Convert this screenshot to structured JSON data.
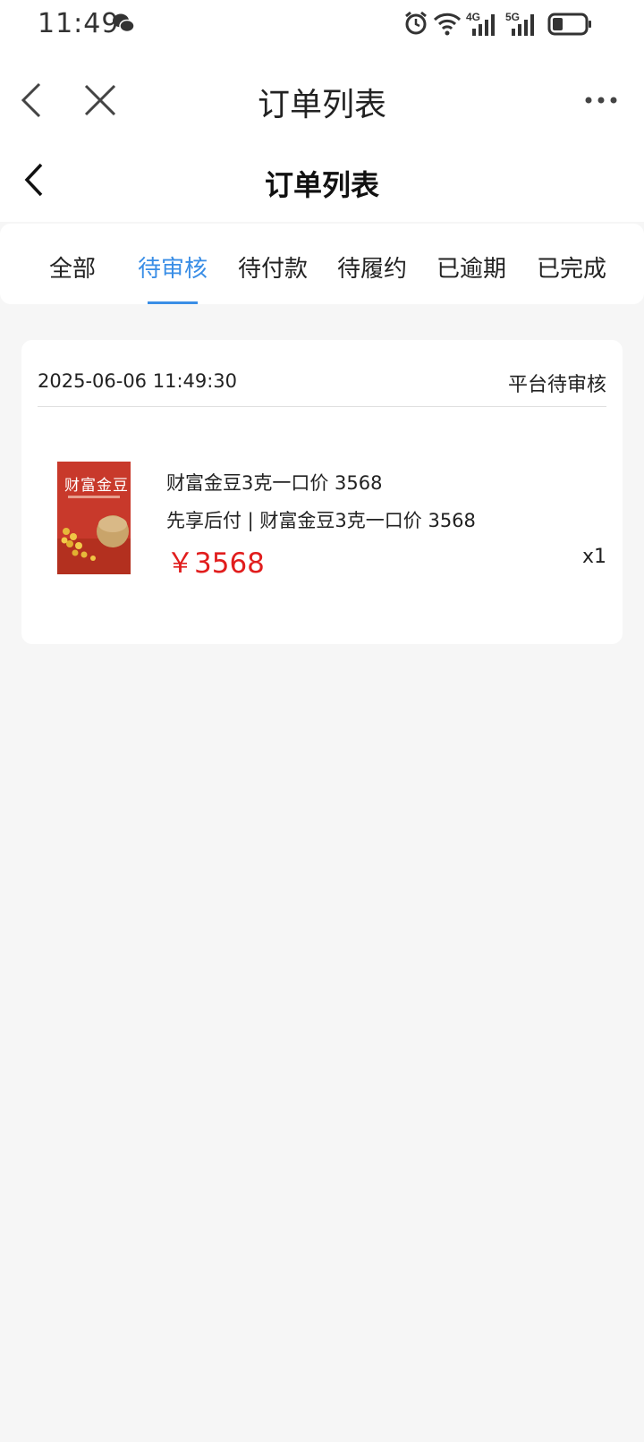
{
  "status_bar": {
    "time": "11:49",
    "icons": [
      "wechat-icon",
      "alarm-icon",
      "wifi-icon",
      "4g-signal-icon",
      "5g-signal-icon",
      "battery-icon"
    ],
    "network_labels": [
      "4G",
      "5G"
    ]
  },
  "webview": {
    "title": "订单列表",
    "icons": [
      "back-icon",
      "close-icon",
      "more-icon"
    ]
  },
  "page": {
    "title": "订单列表"
  },
  "tabs": [
    {
      "label": "全部",
      "active": false
    },
    {
      "label": "待审核",
      "active": true
    },
    {
      "label": "待付款",
      "active": false
    },
    {
      "label": "待履约",
      "active": false
    },
    {
      "label": "已逾期",
      "active": false
    },
    {
      "label": "已完成",
      "active": false
    }
  ],
  "orders": [
    {
      "datetime": "2025-06-06 11:49:30",
      "status": "平台待审核",
      "product": {
        "image_brand_text": "财富金豆",
        "name": "财富金豆3克一口价 3568",
        "description": "先享后付 | 财富金豆3克一口价 3568",
        "price": "￥3568",
        "quantity": "x1"
      }
    }
  ],
  "colors": {
    "accent": "#3a8ee6",
    "price": "#e11d1d",
    "background": "#f6f6f6",
    "card": "#ffffff"
  }
}
